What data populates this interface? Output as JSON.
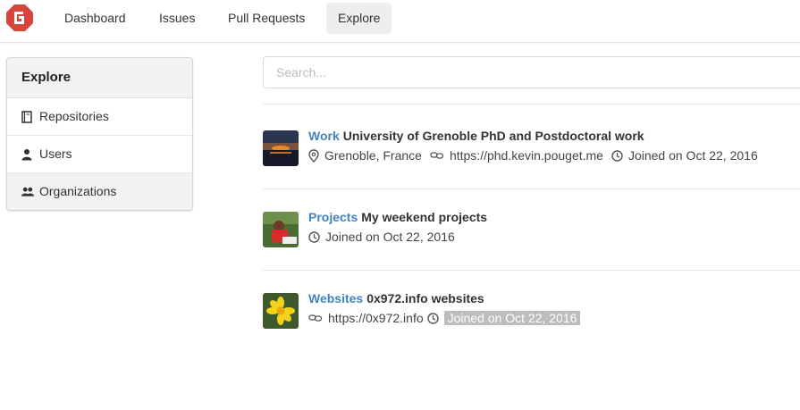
{
  "nav": {
    "items": [
      {
        "label": "Dashboard",
        "active": false
      },
      {
        "label": "Issues",
        "active": false
      },
      {
        "label": "Pull Requests",
        "active": false
      },
      {
        "label": "Explore",
        "active": true
      }
    ]
  },
  "sidebar": {
    "title": "Explore",
    "items": [
      {
        "label": "Repositories",
        "icon": "book-icon",
        "active": false
      },
      {
        "label": "Users",
        "icon": "person-icon",
        "active": false
      },
      {
        "label": "Organizations",
        "icon": "people-icon",
        "active": true
      }
    ]
  },
  "search": {
    "placeholder": "Search...",
    "value": ""
  },
  "orgs": [
    {
      "name": "Work",
      "full_name": "University of Grenoble PhD and Postdoctoral work",
      "location": "Grenoble, France",
      "website": "https://phd.kevin.pouget.me",
      "joined": "Joined on Oct 22, 2016"
    },
    {
      "name": "Projects",
      "full_name": "My weekend projects",
      "joined": "Joined on Oct 22, 2016"
    },
    {
      "name": "Websites",
      "full_name": "0x972.info websites",
      "website": "https://0x972.info",
      "joined": "Joined on Oct 22, 2016"
    }
  ],
  "colors": {
    "link": "#4183c4",
    "selection": "#bdbdbd"
  }
}
